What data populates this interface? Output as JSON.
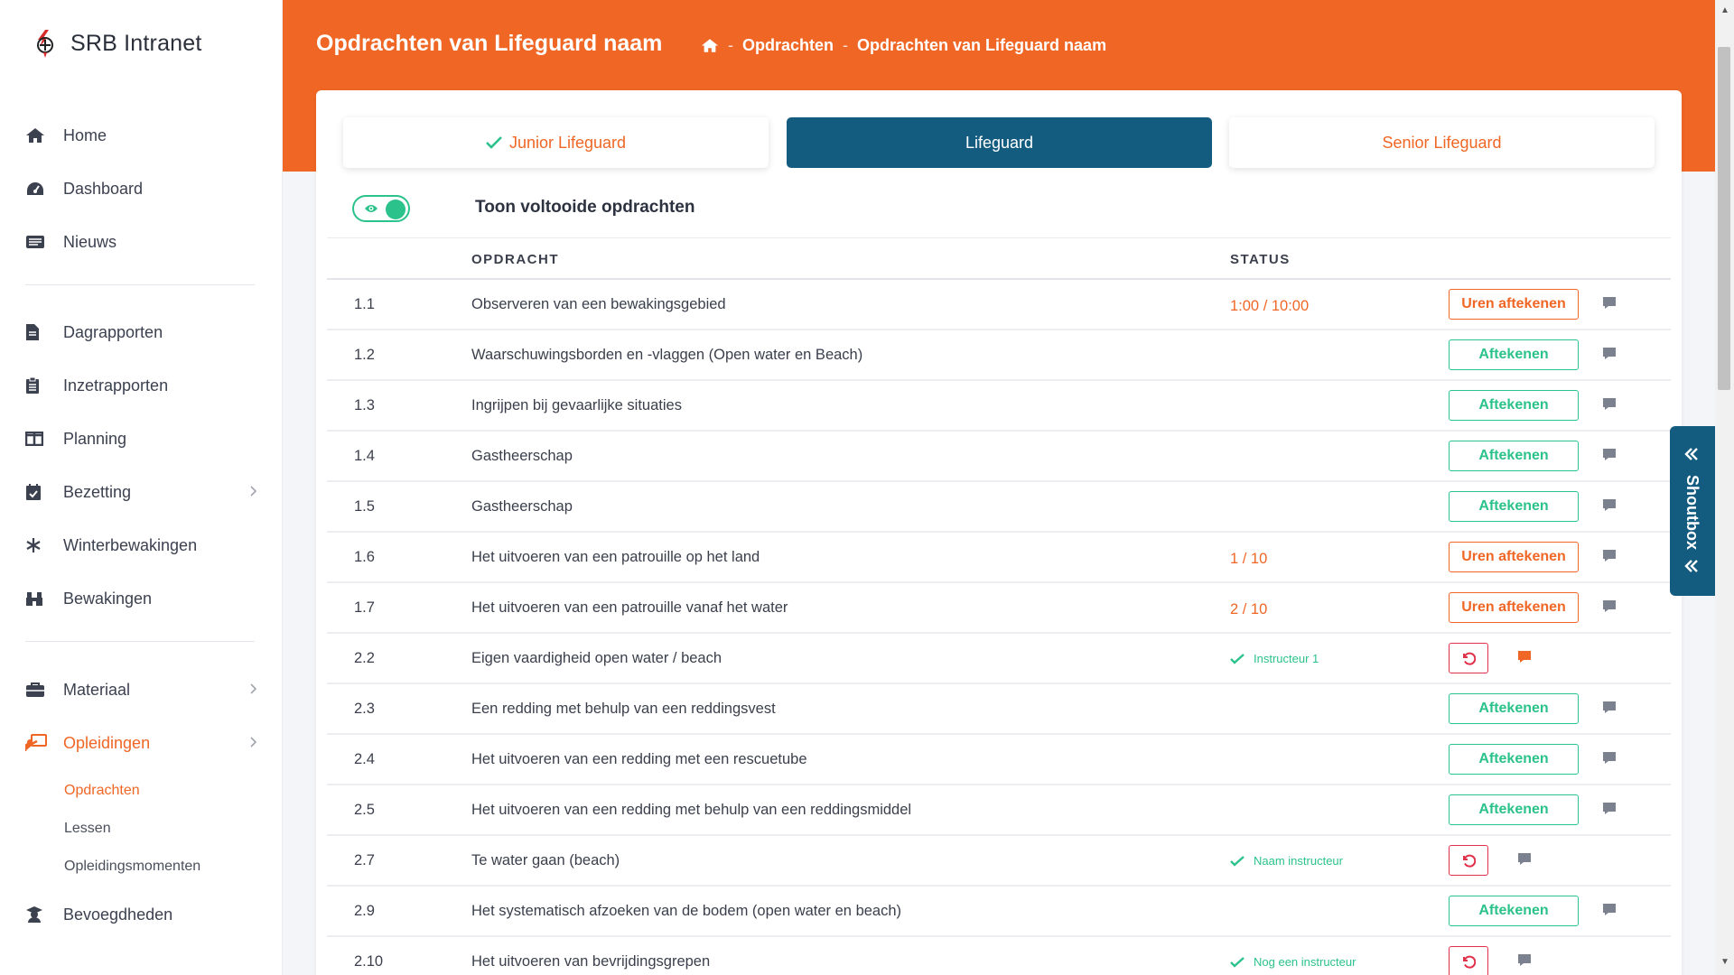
{
  "brand": {
    "name": "SRB Intranet"
  },
  "sidebar": {
    "items": [
      {
        "label": "Home",
        "icon": "home-icon"
      },
      {
        "label": "Dashboard",
        "icon": "dashboard-icon"
      },
      {
        "label": "Nieuws",
        "icon": "news-icon"
      },
      {
        "label": "Dagrapporten",
        "icon": "file-icon"
      },
      {
        "label": "Inzetrapporten",
        "icon": "clipboard-icon"
      },
      {
        "label": "Planning",
        "icon": "columns-icon"
      },
      {
        "label": "Bezetting",
        "icon": "calendar-check-icon"
      },
      {
        "label": "Winterbewakingen",
        "icon": "snowflake-icon"
      },
      {
        "label": "Bewakingen",
        "icon": "binoculars-icon"
      },
      {
        "label": "Materiaal",
        "icon": "toolbox-icon"
      },
      {
        "label": "Opleidingen",
        "icon": "teacher-icon"
      },
      {
        "label": "Bevoegdheden",
        "icon": "graduate-icon"
      }
    ],
    "subitems": [
      {
        "label": "Opdrachten"
      },
      {
        "label": "Lessen"
      },
      {
        "label": "Opleidingsmomenten"
      }
    ]
  },
  "header": {
    "title": "Opdrachten van Lifeguard naam",
    "breadcrumb": [
      "Opdrachten",
      "Opdrachten van Lifeguard naam"
    ]
  },
  "levels": [
    {
      "label": "Junior Lifeguard",
      "completed": true
    },
    {
      "label": "Lifeguard",
      "active": true
    },
    {
      "label": "Senior Lifeguard"
    }
  ],
  "toggle": {
    "label": "Toon voltooide opdrachten",
    "on": true
  },
  "table": {
    "headers": {
      "opdracht": "OPDRACHT",
      "status": "STATUS"
    },
    "rows": [
      {
        "num": "1.1",
        "title": "Observeren van een bewakingsgebied",
        "status": "1:00 / 10:00",
        "status_type": "hours",
        "action": "Uren aftekenen"
      },
      {
        "num": "1.2",
        "title": "Waarschuwingsborden en -vlaggen (Open water en Beach)",
        "status": "",
        "status_type": "none",
        "action": "Aftekenen"
      },
      {
        "num": "1.3",
        "title": "Ingrijpen bij gevaarlijke situaties",
        "status": "",
        "status_type": "none",
        "action": "Aftekenen"
      },
      {
        "num": "1.4",
        "title": "Gastheerschap",
        "status": "",
        "status_type": "none",
        "action": "Aftekenen"
      },
      {
        "num": "1.5",
        "title": "Gastheerschap",
        "status": "",
        "status_type": "none",
        "action": "Aftekenen"
      },
      {
        "num": "1.6",
        "title": "Het uitvoeren van een patrouille op het land",
        "status": "1 / 10",
        "status_type": "hours",
        "action": "Uren aftekenen"
      },
      {
        "num": "1.7",
        "title": "Het uitvoeren van een patrouille vanaf het water",
        "status": "2 / 10",
        "status_type": "hours",
        "action": "Uren aftekenen"
      },
      {
        "num": "2.2",
        "title": "Eigen vaardigheid open water / beach",
        "status": "Instructeur 1",
        "status_type": "done",
        "action": "undo",
        "comment_active": true
      },
      {
        "num": "2.3",
        "title": "Een redding met behulp van een reddingsvest",
        "status": "",
        "status_type": "none",
        "action": "Aftekenen"
      },
      {
        "num": "2.4",
        "title": "Het uitvoeren van een redding met een rescuetube",
        "status": "",
        "status_type": "none",
        "action": "Aftekenen"
      },
      {
        "num": "2.5",
        "title": "Het uitvoeren van een redding met behulp van een reddingsmiddel",
        "status": "",
        "status_type": "none",
        "action": "Aftekenen"
      },
      {
        "num": "2.7",
        "title": "Te water gaan (beach)",
        "status": "Naam instructeur",
        "status_type": "done",
        "action": "undo"
      },
      {
        "num": "2.9",
        "title": "Het systematisch afzoeken van de bodem (open water en beach)",
        "status": "",
        "status_type": "none",
        "action": "Aftekenen"
      },
      {
        "num": "2.10",
        "title": "Het uitvoeren van bevrijdingsgrepen",
        "status": "Nog een instructeur",
        "status_type": "done",
        "action": "undo"
      }
    ]
  },
  "shoutbox": {
    "label": "Shoutbox"
  },
  "colors": {
    "accent": "#ef6625",
    "primary": "#135c7f",
    "success": "#2bc28b",
    "danger": "#e0304a"
  }
}
